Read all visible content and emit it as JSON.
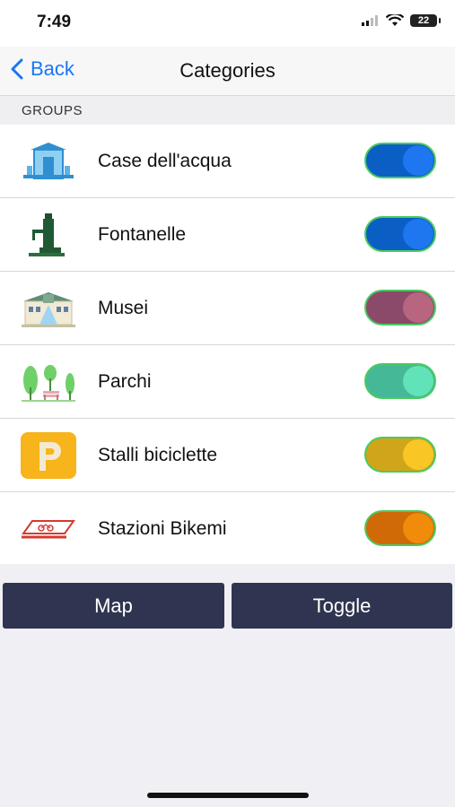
{
  "status_bar": {
    "time": "7:49",
    "battery": "22"
  },
  "nav": {
    "back_label": "Back",
    "title": "Categories"
  },
  "section": {
    "header": "GROUPS"
  },
  "categories": [
    {
      "label": "Case dell'acqua",
      "icon": "water-house-icon",
      "enabled": true,
      "track_color": "#0b5fc4",
      "knob_color": "#1e77f0"
    },
    {
      "label": "Fontanelle",
      "icon": "fountain-icon",
      "enabled": true,
      "track_color": "#0b5fc4",
      "knob_color": "#1e77f0"
    },
    {
      "label": "Musei",
      "icon": "museum-icon",
      "enabled": true,
      "track_color": "#8c4a6a",
      "knob_color": "#b8657f"
    },
    {
      "label": "Parchi",
      "icon": "park-icon",
      "enabled": true,
      "track_color": "#45b997",
      "knob_color": "#62e2b8"
    },
    {
      "label": "Stalli biciclette",
      "icon": "parking-icon",
      "enabled": true,
      "track_color": "#d0a51a",
      "knob_color": "#f8c625"
    },
    {
      "label": "Stazioni Bikemi",
      "icon": "bike-station-icon",
      "enabled": true,
      "track_color": "#cf6a06",
      "knob_color": "#f08c0a"
    }
  ],
  "buttons": {
    "map": "Map",
    "toggle": "Toggle"
  }
}
